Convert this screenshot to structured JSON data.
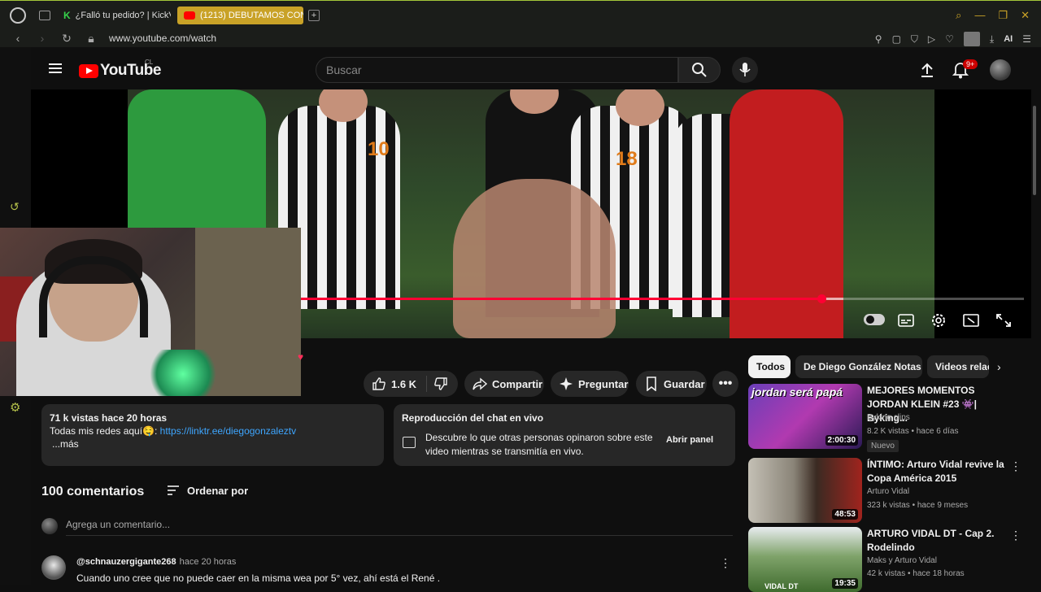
{
  "browser": {
    "tabs": [
      {
        "label": "¿Falló tu pedido? | KickVie",
        "icon": "k-icon"
      },
      {
        "label": "(1213) DEBUTAMOS CON ",
        "icon": "youtube-icon",
        "active": true
      }
    ],
    "url": "www.youtube.com/watch",
    "ai_label": "AI"
  },
  "header": {
    "logo_text": "YouTube",
    "region": "CL",
    "search_placeholder": "Buscar",
    "notification_count": "9+"
  },
  "player": {
    "progress_fraction": 0.72,
    "buffered_fraction": 0.75,
    "jersey_numbers": [
      "10",
      "18"
    ]
  },
  "actions": {
    "likes": "1.6 K",
    "share": "Compartir",
    "ask": "Preguntar",
    "save": "Guardar"
  },
  "description": {
    "views_time": "71 k vistas  hace 20 horas",
    "line_prefix": "Todas mis redes aquí🤤: ",
    "link": "https://linktr.ee/diegogonzaleztv",
    "more": "...más"
  },
  "chat_replay": {
    "title": "Reproducción del chat en vivo",
    "description": "Descubre lo que otras personas opinaron sobre este video mientras se transmitía en vivo.",
    "button": "Abrir panel"
  },
  "comments": {
    "count_label": "100 comentarios",
    "sort_label": "Ordenar por",
    "input_placeholder": "Agrega un comentario...",
    "items": [
      {
        "author": "@schnauzergigante268",
        "time": "hace 20 horas",
        "text": "Cuando uno cree que no puede caer en la misma wea por 5° vez, ahí está el René ."
      }
    ]
  },
  "chips": [
    "Todos",
    "De Diego González Notas",
    "Videos relac"
  ],
  "recommendations": [
    {
      "title": "MEJORES MOMENTOS JORDAN KLEIN #23 👾| Byking...",
      "channel": "Byking clips",
      "stats": "8.2 K vistas • hace 6 días",
      "badge": "Nuevo",
      "duration": "2:00:30",
      "thumb_text": "jordan será papá"
    },
    {
      "title": "ÍNTIMO: Arturo Vidal revive la Copa América 2015",
      "channel": "Arturo Vidal",
      "stats": "323 k vistas • hace 9 meses",
      "duration": "48:53"
    },
    {
      "title": "ARTURO VIDAL DT - Cap 2. Rodelindo",
      "channel": "Maks y Arturo Vidal",
      "stats": "42 k vistas • hace 18 horas",
      "duration": "19:35",
      "thumb_text": "VIDAL DT"
    }
  ],
  "colors": {
    "accent_red": "#ff0033",
    "link_blue": "#3ea6ff",
    "opera_accent": "#c9a227"
  }
}
